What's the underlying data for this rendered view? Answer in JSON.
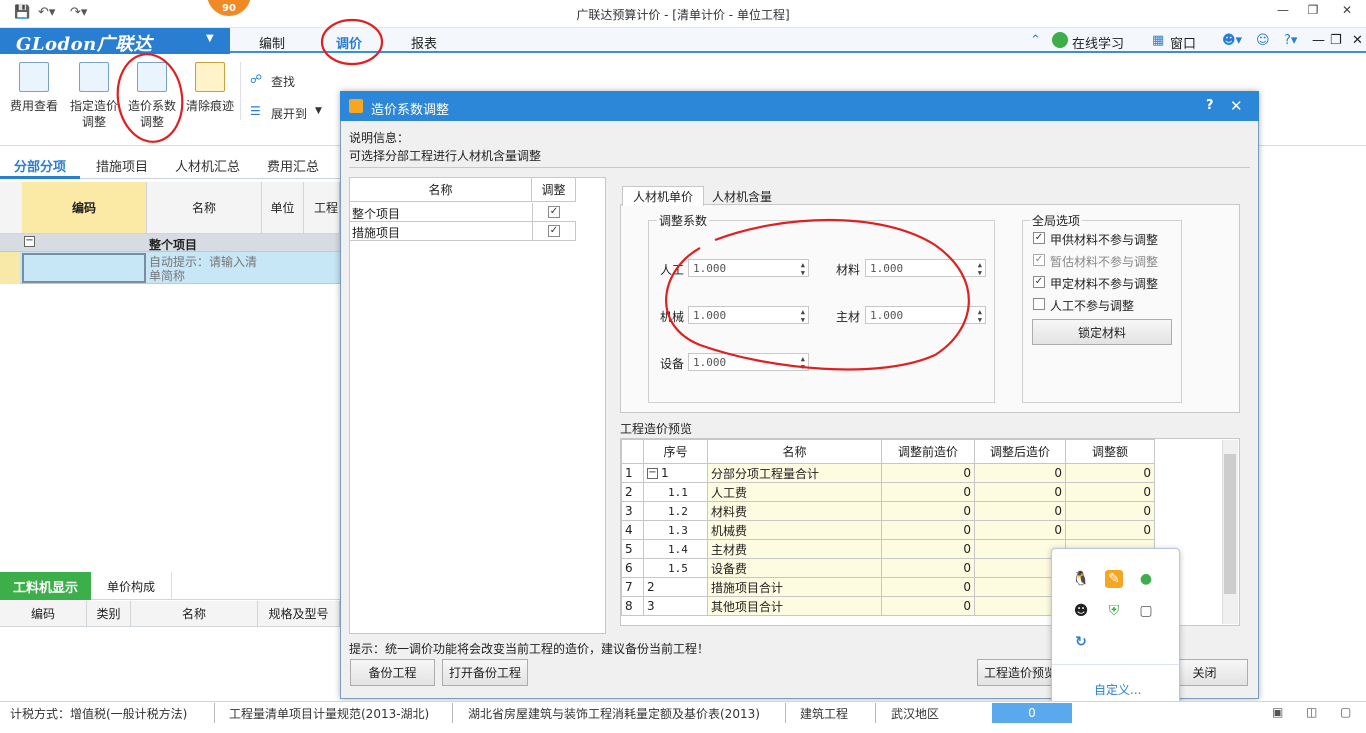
{
  "window": {
    "title": "广联达预算计价 - [清单计价 - 单位工程]",
    "badge": "90"
  },
  "logo": {
    "brand": "GLodon广联达"
  },
  "menu": {
    "items": [
      "编制",
      "调价",
      "报表"
    ],
    "right": [
      "在线学习",
      "窗口"
    ]
  },
  "ribbon": {
    "buttons": [
      "费用查看",
      "指定造价调整",
      "造价系数调整",
      "清除痕迹"
    ],
    "find": "查找",
    "expand": "展开到"
  },
  "tabs": [
    "分部分项",
    "措施项目",
    "人材机汇总",
    "费用汇总"
  ],
  "grid": {
    "headers": [
      "编码",
      "名称",
      "单位",
      "工程"
    ],
    "group_row": "整个项目",
    "hint_row": "自动提示：请输入清单简称"
  },
  "bottom": {
    "tabs": [
      "工料机显示",
      "单价构成"
    ],
    "headers": [
      "编码",
      "类别",
      "名称",
      "规格及型号"
    ]
  },
  "dialog": {
    "title": "造价系数调整",
    "desc_label": "说明信息：",
    "desc": "可选择分部工程进行人材机含量调整",
    "left_headers": [
      "名称",
      "调整"
    ],
    "left_rows": [
      {
        "name": "整个项目",
        "checked": true
      },
      {
        "name": "措施项目",
        "checked": true
      }
    ],
    "tabs": [
      "人材机单价",
      "人材机含量"
    ],
    "coef_group": "调整系数",
    "coefs": {
      "labor_label": "人工",
      "labor": "1.000",
      "material_label": "材料",
      "material": "1.000",
      "machine_label": "机械",
      "machine": "1.000",
      "main_label": "主材",
      "main": "1.000",
      "equip_label": "设备",
      "equip": "1.000"
    },
    "global_group": "全局选项",
    "options": [
      {
        "label": "甲供材料不参与调整",
        "checked": true
      },
      {
        "label": "暂估材料不参与调整",
        "checked": true
      },
      {
        "label": "甲定材料不参与调整",
        "checked": true
      },
      {
        "label": "人工不参与调整",
        "checked": false
      }
    ],
    "lock_button": "锁定材料",
    "preview_title": "工程造价预览",
    "preview_headers": [
      "序号",
      "名称",
      "调整前造价",
      "调整后造价",
      "调整额"
    ],
    "preview_rows": [
      {
        "n": "1",
        "seq": "1",
        "name": "分部分项工程量合计",
        "before": "0",
        "after": "0",
        "diff": "0"
      },
      {
        "n": "2",
        "seq": "1.1",
        "name": "人工费",
        "before": "0",
        "after": "0",
        "diff": "0"
      },
      {
        "n": "3",
        "seq": "1.2",
        "name": "材料费",
        "before": "0",
        "after": "0",
        "diff": "0"
      },
      {
        "n": "4",
        "seq": "1.3",
        "name": "机械费",
        "before": "0",
        "after": "0",
        "diff": "0"
      },
      {
        "n": "5",
        "seq": "1.4",
        "name": "主材费",
        "before": "0",
        "after": "",
        "diff": ""
      },
      {
        "n": "6",
        "seq": "1.5",
        "name": "设备费",
        "before": "0",
        "after": "",
        "diff": ""
      },
      {
        "n": "7",
        "seq": "2",
        "name": "措施项目合计",
        "before": "0",
        "after": "",
        "diff": ""
      },
      {
        "n": "8",
        "seq": "3",
        "name": "其他项目合计",
        "before": "0",
        "after": "",
        "diff": ""
      }
    ],
    "tip": "提示：统一调价功能将会改变当前工程的造价，建议备份当前工程！",
    "buttons": {
      "backup": "备份工程",
      "open_backup": "打开备份工程",
      "preview": "工程造价预览",
      "close": "关闭"
    }
  },
  "tray": {
    "customize": "自定义..."
  },
  "status": {
    "items": [
      "计税方式：增值税(一般计税方法)",
      "工程量清单项目计量规范(2013-湖北)",
      "湖北省房屋建筑与装饰工程消耗量定额及基价表(2013)",
      "建筑工程",
      "武汉地区"
    ],
    "value": "0"
  },
  "colors": {
    "accent": "#2a7ed2",
    "annotation": "#e02020"
  }
}
